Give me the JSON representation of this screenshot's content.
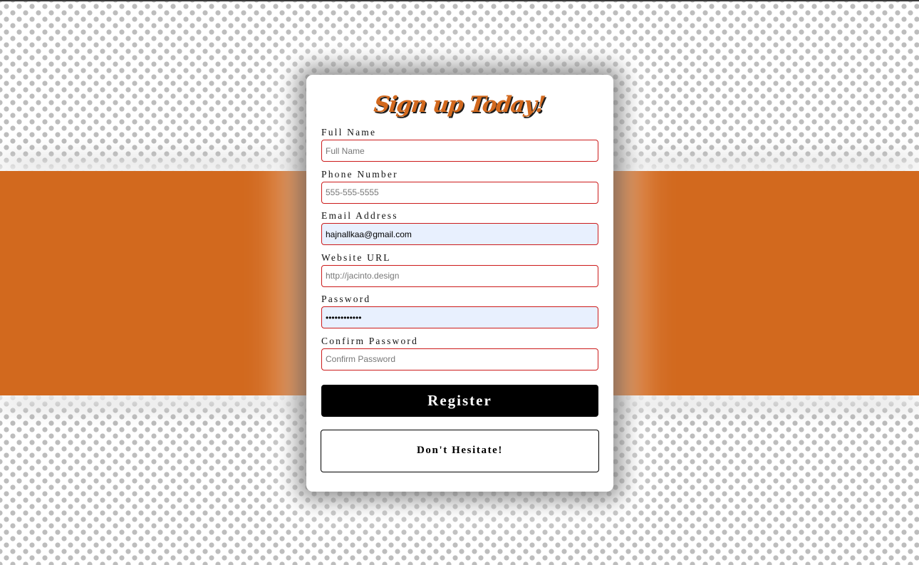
{
  "colors": {
    "accent": "#d2691e",
    "field_border": "#cc1b1b",
    "autofill_background": "#e8f0fe",
    "button_background": "#000000"
  },
  "form": {
    "title": "Sign up Today!",
    "fields": [
      {
        "label": "Full Name",
        "placeholder": "Full Name",
        "value": ""
      },
      {
        "label": "Phone Number",
        "placeholder": "555-555-5555",
        "value": ""
      },
      {
        "label": "Email Address",
        "placeholder": "",
        "value": "hajnallkaa@gmail.com"
      },
      {
        "label": "Website URL",
        "placeholder": "http://jacinto.design",
        "value": ""
      },
      {
        "label": "Password",
        "placeholder": "",
        "value": "••••••••••••"
      },
      {
        "label": "Confirm Password",
        "placeholder": "Confirm Password",
        "value": ""
      }
    ],
    "register_label": "Register",
    "hesitate_label": "Don't Hesitate!"
  }
}
